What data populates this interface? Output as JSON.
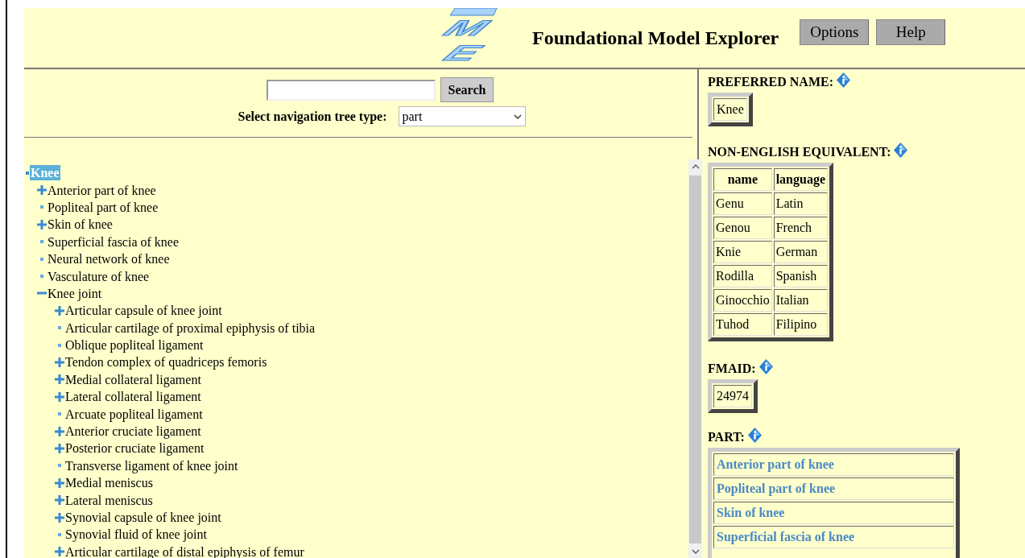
{
  "header": {
    "logo": [
      "M",
      "E"
    ],
    "title": "Foundational Model Explorer",
    "buttons": [
      "Options",
      "Help"
    ]
  },
  "search": {
    "button": "Search",
    "tree_type_label": "Select navigation tree type:",
    "tree_type": "part"
  },
  "tree": [
    {
      "label": "Knee",
      "kind": "branch",
      "expanded": true,
      "selected": true,
      "children": [
        {
          "label": "Anterior part of knee",
          "kind": "branch",
          "expanded": false,
          "selected": false
        },
        {
          "label": "Popliteal part of knee",
          "kind": "leaf",
          "selected": false
        },
        {
          "label": "Skin of knee",
          "kind": "branch",
          "expanded": false,
          "selected": false
        },
        {
          "label": "Superficial fascia of knee",
          "kind": "leaf",
          "selected": false
        },
        {
          "label": "Neural network of knee",
          "kind": "leaf",
          "selected": false
        },
        {
          "label": "Vasculature of knee",
          "kind": "leaf",
          "selected": false
        },
        {
          "label": "Knee joint",
          "kind": "branch",
          "expanded": true,
          "selected": false,
          "children": [
            {
              "label": "Articular capsule of knee joint",
              "kind": "branch",
              "expanded": false,
              "selected": false
            },
            {
              "label": "Articular cartilage of proximal epiphysis of tibia",
              "kind": "leaf",
              "selected": false
            },
            {
              "label": "Oblique popliteal ligament",
              "kind": "leaf",
              "selected": false
            },
            {
              "label": "Tendon complex of quadriceps femoris",
              "kind": "branch",
              "expanded": false,
              "selected": false
            },
            {
              "label": "Medial collateral ligament",
              "kind": "branch",
              "expanded": false,
              "selected": false
            },
            {
              "label": "Lateral collateral ligament",
              "kind": "branch",
              "expanded": false,
              "selected": false
            },
            {
              "label": "Arcuate popliteal ligament",
              "kind": "leaf",
              "selected": false
            },
            {
              "label": "Anterior cruciate ligament",
              "kind": "branch",
              "expanded": false,
              "selected": false
            },
            {
              "label": "Posterior cruciate ligament",
              "kind": "branch",
              "expanded": false,
              "selected": false
            },
            {
              "label": "Transverse ligament of knee joint",
              "kind": "leaf",
              "selected": false
            },
            {
              "label": "Medial meniscus",
              "kind": "branch",
              "expanded": false,
              "selected": false
            },
            {
              "label": "Lateral meniscus",
              "kind": "branch",
              "expanded": false,
              "selected": false
            },
            {
              "label": "Synovial capsule of knee joint",
              "kind": "branch",
              "expanded": false,
              "selected": false
            },
            {
              "label": "Synovial fluid of knee joint",
              "kind": "leaf",
              "selected": false
            },
            {
              "label": "Articular cartilage of distal epiphysis of femur",
              "kind": "branch",
              "expanded": false,
              "selected": false
            }
          ]
        }
      ]
    }
  ],
  "details": {
    "preferred_name_label": "PREFERRED NAME:",
    "preferred_name": "Knee",
    "non_english_label": "NON-ENGLISH EQUIVALENT:",
    "non_english_columns": [
      "name",
      "language"
    ],
    "non_english_rows": [
      [
        "Genu",
        "Latin"
      ],
      [
        "Genou",
        "French"
      ],
      [
        "Knie",
        "German"
      ],
      [
        "Rodilla",
        "Spanish"
      ],
      [
        "Ginocchio",
        "Italian"
      ],
      [
        "Tuhod",
        "Filipino"
      ]
    ],
    "fmaid_label": "FMAID:",
    "fmaid": "24974",
    "part_label": "PART:",
    "parts": [
      "Anterior part of knee",
      "Popliteal part of knee",
      "Skin of knee",
      "Superficial fascia of knee"
    ]
  }
}
